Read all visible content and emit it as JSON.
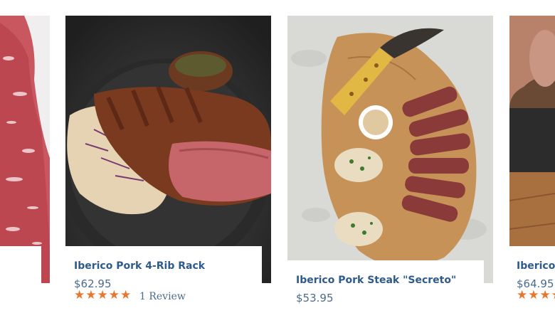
{
  "products": [
    {
      "title": "",
      "price": "",
      "stars": ""
    },
    {
      "title": "Iberico Pork 4-Rib Rack",
      "price": "$62.95",
      "stars": "★★★★★",
      "rating": 5,
      "review": "1 Review"
    },
    {
      "title": "Iberico Pork Steak \"Secreto\"",
      "price": "$53.95"
    },
    {
      "title": "Iberico I",
      "price": "$64.95",
      "stars": "★★★★"
    }
  ],
  "colors": {
    "title": "#2e5a8c",
    "price": "#4b6b8c",
    "star": "#e8772e"
  }
}
